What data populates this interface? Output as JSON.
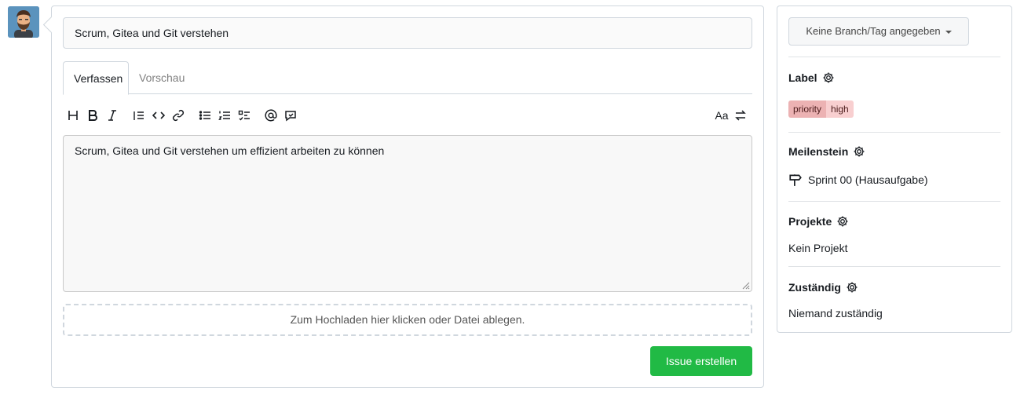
{
  "issue": {
    "title_value": "Scrum, Gitea und Git verstehen",
    "body_value": "Scrum, Gitea und Git verstehen um effizient arbeiten zu können"
  },
  "tabs": {
    "write": "Verfassen",
    "preview": "Vorschau"
  },
  "toolbar": {
    "icons": [
      "heading-icon",
      "bold-icon",
      "italic-icon",
      "quote-icon",
      "code-icon",
      "link-icon",
      "unordered-list-icon",
      "ordered-list-icon",
      "task-list-icon",
      "mention-icon",
      "reference-icon",
      "monospace-toggle-icon",
      "switch-editor-icon"
    ]
  },
  "upload": {
    "dropzone_text": "Zum Hochladen hier klicken oder Datei ablegen."
  },
  "actions": {
    "submit_label": "Issue erstellen"
  },
  "sidebar": {
    "branch_label": "Keine Branch/Tag angegeben",
    "labels_heading": "Label",
    "label_scope": "priority",
    "label_value": "high",
    "milestone_heading": "Meilenstein",
    "milestone_value": "Sprint 00 (Hausaufgabe)",
    "projects_heading": "Projekte",
    "projects_value": "Kein Projekt",
    "assignees_heading": "Zuständig",
    "assignees_value": "Niemand zuständig"
  },
  "colors": {
    "primary_green": "#21ba45",
    "label_scope_bg": "#ecb2b3",
    "label_value_bg": "#f8cfd0",
    "border": "#d0d7de"
  }
}
